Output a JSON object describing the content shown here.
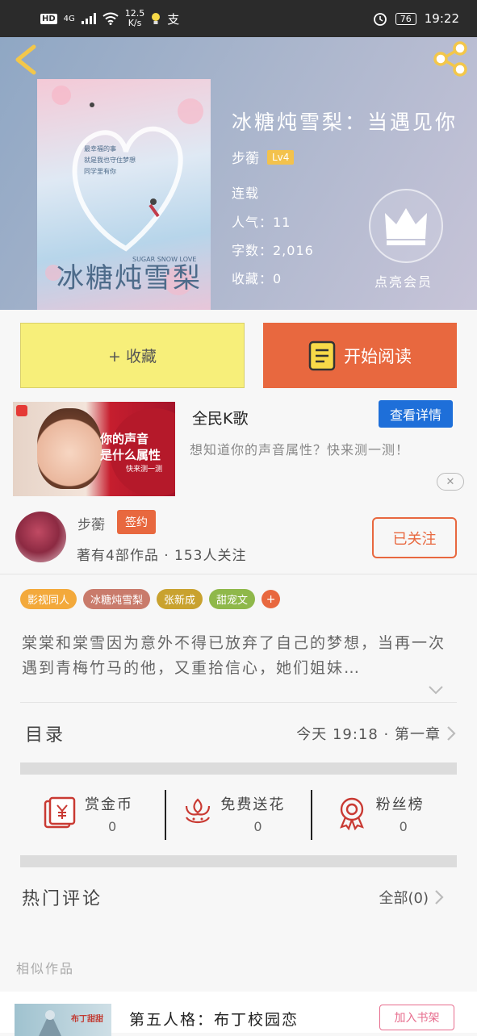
{
  "status_bar": {
    "network": "4G",
    "speed": "12.5\nK/s",
    "app_char": "支",
    "battery": "76",
    "time": "19:22"
  },
  "book": {
    "title": "冰糖炖雪梨：当遇见你",
    "cover_title": "冰糖炖雪梨",
    "cover_note": "最幸福的事\n就是我也守住梦想\n同学里有你",
    "cover_small": "SUGAR SNOW LOVE",
    "author": "步蘅",
    "level": "Lv4",
    "status": "连载",
    "popularity": "人气：11",
    "word_count": "字数：2,016",
    "favorites": "收藏：0",
    "vip_label": "点亮会员"
  },
  "actions": {
    "collect_label": "+ 收藏",
    "read_label": "开始阅读"
  },
  "ad": {
    "image_text_1": "你的声音",
    "image_text_2": "是什么属性",
    "image_sub": "快来测一测",
    "name": "全民K歌",
    "detail_label": "查看详情",
    "description": "想知道你的声音属性？快来测一测！",
    "close_label": "✕"
  },
  "author": {
    "name": "步蘅",
    "badge": "签约",
    "stats": "著有4部作品 · 153人关注",
    "follow_label": "已关注"
  },
  "tags": [
    {
      "label": "影视同人",
      "color": "#f3a93b"
    },
    {
      "label": "冰糖炖雪梨",
      "color": "#c97b6b"
    },
    {
      "label": "张新成",
      "color": "#c9a22f"
    },
    {
      "label": "甜宠文",
      "color": "#8fb84a"
    }
  ],
  "tag_more": "+",
  "synopsis": "棠棠和棠雪因为意外不得已放弃了自己的梦想，当再一次遇到青梅竹马的他，又重拾信心，她们姐妹…",
  "toc": {
    "label": "目录",
    "latest": "今天 19:18 · 第一章"
  },
  "rewards": [
    {
      "label": "赏金币",
      "count": "0",
      "icon": "red-envelope-icon"
    },
    {
      "label": "免费送花",
      "count": "0",
      "icon": "flower-icon"
    },
    {
      "label": "粉丝榜",
      "count": "0",
      "icon": "medal-icon"
    }
  ],
  "comments": {
    "title": "热门评论",
    "all_label": "全部(0)"
  },
  "similar": {
    "section_label": "相似作品",
    "title": "第五人格：布丁校园恋",
    "thumb_text": "布丁甜甜",
    "add_label": "加入书架"
  },
  "colors": {
    "accent": "#e8683f",
    "collect_bg": "#f7ef7a",
    "ad_button": "#1e6fd9",
    "pink": "#e76c8d"
  }
}
